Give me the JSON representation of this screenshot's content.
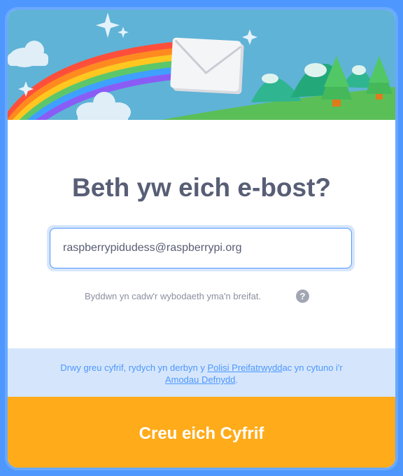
{
  "dialog": {
    "title": "Beth yw eich e-bost?",
    "email": {
      "value": "raspberrypidudess@raspberrypi.org",
      "placeholder": ""
    },
    "privacy_note": "Byddwn yn cadw'r wybodaeth yma'n breifat.",
    "help_icon": "?",
    "terms": {
      "prefix": "Drwy greu cyfrif, rydych yn derbyn y ",
      "privacy_link": "Polisi Preifatrwydd",
      "middle": "ac yn cytuno i'r ",
      "terms_link": "Amodau Defnydd",
      "suffix": "."
    },
    "submit_label": "Creu eich Cyfrif"
  },
  "icons": {
    "header": "email-envelope-illustration",
    "help": "question-mark-icon"
  },
  "colors": {
    "page_background": "#4d97ff",
    "title_text": "#575e75",
    "accent": "#4d97ff",
    "terms_background": "#d5e6fc",
    "button_background": "#ffab1a"
  }
}
